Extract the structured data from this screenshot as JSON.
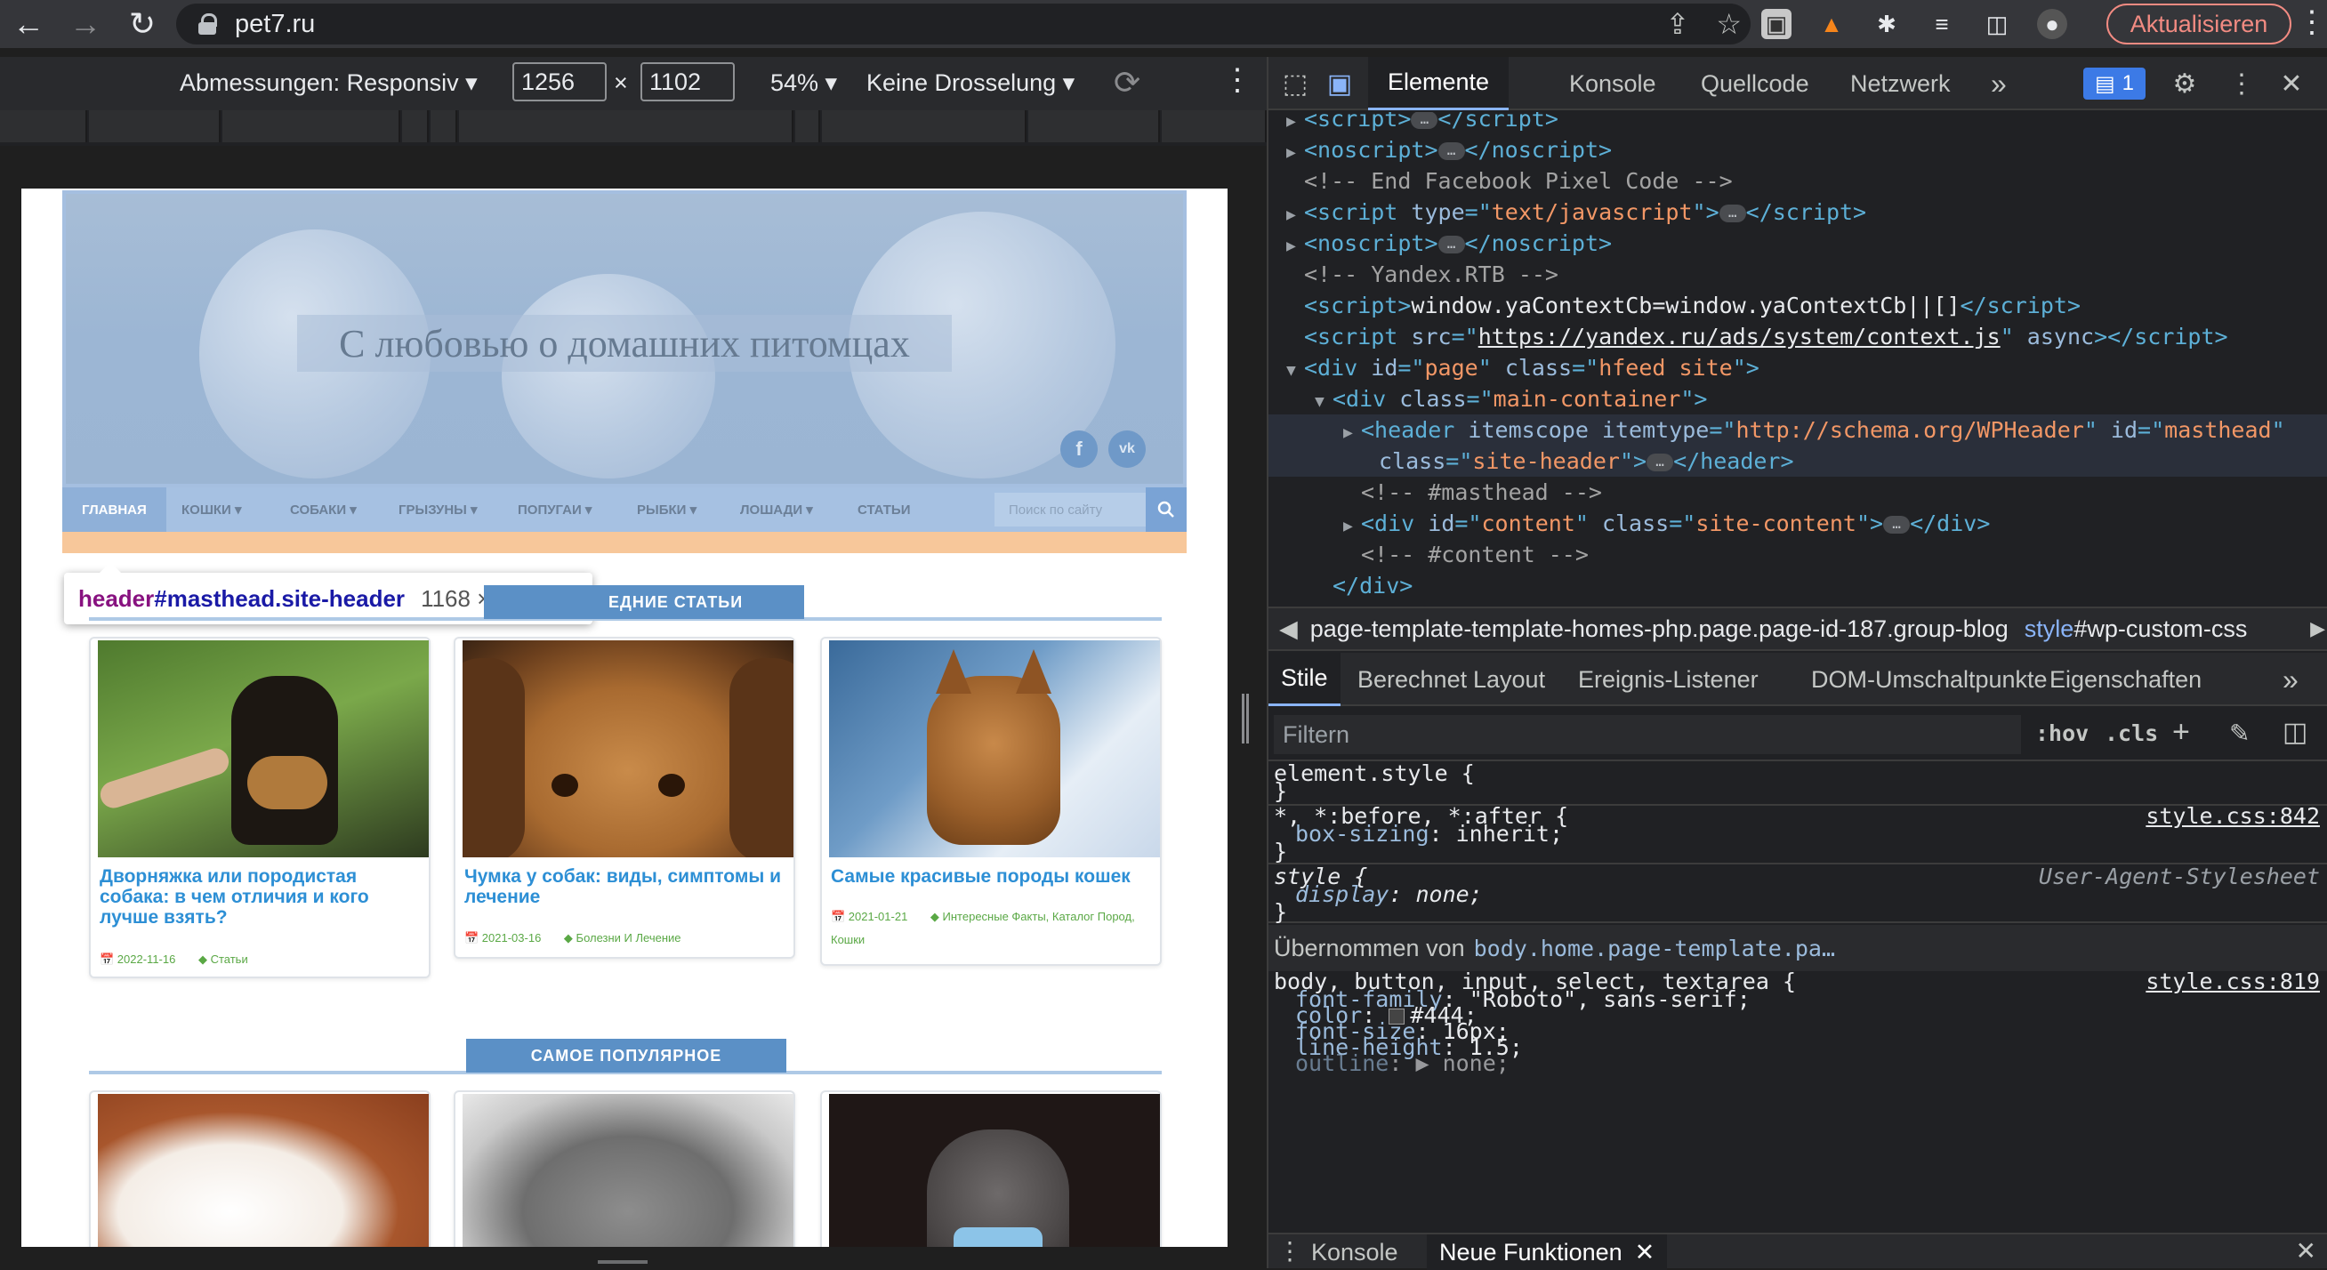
{
  "browser": {
    "url": "pet7.ru",
    "update_label": "Aktualisieren"
  },
  "device_toolbar": {
    "dimensions_label": "Abmessungen: Responsiv ▾",
    "width": "1256",
    "times": "×",
    "height": "1102",
    "zoom": "54% ▾",
    "throttle": "Keine Drosselung ▾"
  },
  "site": {
    "title": "С любовью о домашних питомцах",
    "social": [
      "f",
      "vk"
    ],
    "menu": [
      {
        "label": "ГЛАВНАЯ",
        "active": true
      },
      {
        "label": "КОШКИ ▾"
      },
      {
        "label": "СОБАКИ ▾"
      },
      {
        "label": "ГРЫЗУНЫ ▾"
      },
      {
        "label": "ПОПУГАИ ▾"
      },
      {
        "label": "РЫБКИ ▾"
      },
      {
        "label": "ЛОШАДИ ▾"
      },
      {
        "label": "СТАТЬИ"
      }
    ],
    "search_placeholder": "Поиск по сайту",
    "section_latest": "ЕДНИЕ СТАТЬИ",
    "section_popular": "САМОЕ ПОПУЛЯРНОЕ",
    "cards": [
      {
        "title": "Дворняжка или породистая собака: в чем отличия и кого лучше взять?",
        "date": "📅 2022-11-16",
        "category": "◆ Статьи"
      },
      {
        "title": "Чумка у собак: виды, симптомы и лечение",
        "date": "📅 2021-03-16",
        "category": "◆ Болезни И Лечение"
      },
      {
        "title": "Самые красивые породы кошек",
        "date": "📅 2021-01-21",
        "category": "◆ Интересные Факты, Каталог Пород, Кошки"
      }
    ]
  },
  "inspect_tooltip": {
    "tag": "header",
    "selector": "#masthead.site-header",
    "size": "1168 × 361.39"
  },
  "devtools": {
    "tabs": [
      "Elemente",
      "Konsole",
      "Quellcode",
      "Netzwerk"
    ],
    "more": "»",
    "issues_count": "1",
    "dom_lines": [
      {
        "indent": 0,
        "tri": "▶",
        "html": "<span class='t'>&lt;script&gt;</span><span class='ell'>…</span><span class='t'>&lt;/script&gt;</span>"
      },
      {
        "indent": 0,
        "tri": "▶",
        "html": "<span class='t'>&lt;noscript&gt;</span><span class='ell'>…</span><span class='t'>&lt;/noscript&gt;</span>"
      },
      {
        "indent": 0,
        "tri": "",
        "html": "<span class='c'>&lt;!-- End Facebook Pixel Code --&gt;</span>"
      },
      {
        "indent": 0,
        "tri": "▶",
        "html": "<span class='t'>&lt;script </span><span class='a'>type</span><span class='t'>=\"</span><span class='v'>text/javascript</span><span class='t'>\"&gt;</span><span class='ell'>…</span><span class='t'>&lt;/script&gt;</span>"
      },
      {
        "indent": 0,
        "tri": "▶",
        "html": "<span class='t'>&lt;noscript&gt;</span><span class='ell'>…</span><span class='t'>&lt;/noscript&gt;</span>"
      },
      {
        "indent": 0,
        "tri": "",
        "html": "<span class='c'>&lt;!-- Yandex.RTB --&gt;</span>"
      },
      {
        "indent": 0,
        "tri": "",
        "html": "<span class='t'>&lt;script&gt;</span>window.yaContextCb=window.yaContextCb||[]<span class='t'>&lt;/script&gt;</span>"
      },
      {
        "indent": 0,
        "tri": "",
        "html": "<span class='t'>&lt;script </span><span class='a'>src</span><span class='t'>=\"</span><span class='link'>https://yandex.ru/ads/system/context.js</span><span class='t'>\" </span><span class='a'>async</span><span class='t'>&gt;&lt;/script&gt;</span>"
      },
      {
        "indent": 0,
        "tri": "▼",
        "html": "<span class='t'>&lt;div </span><span class='a'>id</span><span class='t'>=\"</span><span class='v'>page</span><span class='t'>\" </span><span class='a'>class</span><span class='t'>=\"</span><span class='v'>hfeed site</span><span class='t'>\"&gt;</span>"
      },
      {
        "indent": 1,
        "tri": "▼",
        "html": "<span class='t'>&lt;div </span><span class='a'>class</span><span class='t'>=\"</span><span class='v'>main-container</span><span class='t'>\"&gt;</span>"
      },
      {
        "indent": 2,
        "tri": "▶",
        "sel": true,
        "html": "<span class='t'>&lt;header </span><span class='a'>itemscope itemtype</span><span class='t'>=\"</span><span class='v'>http://schema.org/WPHeader</span><span class='t'>\" </span><span class='a'>id</span><span class='t'>=\"</span><span class='v'>masthead</span><span class='t'>\"</span>"
      },
      {
        "indent": 2,
        "tri": "",
        "sel": true,
        "html": "<span class='a'>class</span><span class='t'>=\"</span><span class='v'>site-header</span><span class='t'>\"&gt;</span><span class='ell'>…</span><span class='t'>&lt;/header&gt;</span>"
      },
      {
        "indent": 2,
        "tri": "",
        "html": "<span class='c'>&lt;!-- #masthead --&gt;</span>"
      },
      {
        "indent": 2,
        "tri": "▶",
        "html": "<span class='t'>&lt;div </span><span class='a'>id</span><span class='t'>=\"</span><span class='v'>content</span><span class='t'>\" </span><span class='a'>class</span><span class='t'>=\"</span><span class='v'>site-content</span><span class='t'>\"&gt;</span><span class='ell'>…</span><span class='t'>&lt;/div&gt;</span>"
      },
      {
        "indent": 2,
        "tri": "",
        "html": "<span class='c'>&lt;!-- #content --&gt;</span>"
      },
      {
        "indent": 1,
        "tri": "",
        "html": "<span class='t'>&lt;/div&gt;</span>"
      }
    ],
    "breadcrumb_main": "page-template-template-homes-php.page.page-id-187.group-blog",
    "breadcrumb_style_tag": "style",
    "breadcrumb_style_id": "#wp-custom-css",
    "sub_tabs": [
      "Stile",
      "Berechnet",
      "Layout",
      "Ereignis-Listener",
      "DOM-Umschaltpunkte",
      "Eigenschaften"
    ],
    "filter_placeholder": "Filtern",
    "hov": ":hov",
    "cls": ".cls",
    "styles": {
      "element_style": "element.style {",
      "close": "}",
      "rule1_selector": "*, *:before, *:after {",
      "rule1_prop": "box-sizing",
      "rule1_val": "inherit;",
      "rule1_src": "style.css:842",
      "rule2_selector": "style {",
      "rule2_prop": "display",
      "rule2_val": "none;",
      "rule2_src": "User-Agent-Stylesheet",
      "inherited_label": "Übernommen von",
      "inherited_from": "body.home.page-template.pa…",
      "rule3_selector": "body, button, input, select, textarea {",
      "rule3_src": "style.css:819",
      "rule3_props": [
        {
          "name": "font-family",
          "value": "\"Roboto\", sans-serif;"
        },
        {
          "name": "color",
          "value": "#444;"
        },
        {
          "name": "font-size",
          "value": "16px;"
        },
        {
          "name": "line-height",
          "value": "1.5;"
        },
        {
          "name": "outline",
          "value": "▶ none;"
        }
      ]
    },
    "drawer_tabs": [
      "Konsole",
      "Neue Funktionen"
    ]
  }
}
